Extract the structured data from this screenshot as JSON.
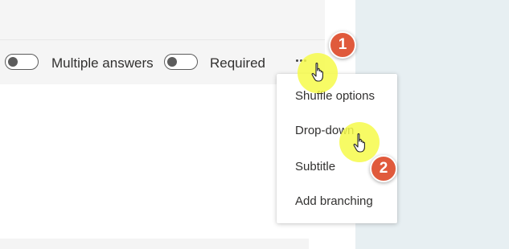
{
  "toolbar": {
    "multiple_answers": {
      "label": "Multiple answers",
      "on": false
    },
    "required": {
      "label": "Required",
      "on": false
    },
    "more_options_icon": "ellipsis-icon"
  },
  "more_menu": {
    "items": [
      {
        "label": "Shuffle options"
      },
      {
        "label": "Drop-down"
      },
      {
        "label": "Subtitle"
      },
      {
        "label": "Add branching"
      }
    ]
  },
  "annotations": {
    "step1": "1",
    "step2": "2",
    "badge_color": "#e05a3c",
    "highlight_color": "#f6fa4a"
  },
  "colors": {
    "toolbar_bg": "#f5f5f5",
    "side_panel_bg": "#e7eff2",
    "text": "#323130"
  }
}
